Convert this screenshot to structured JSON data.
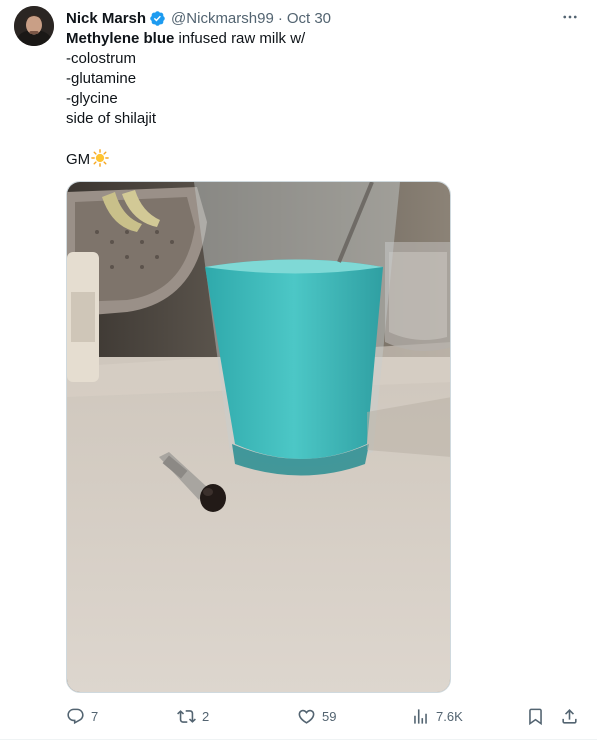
{
  "author": {
    "display_name": "Nick Marsh",
    "handle": "@Nickmarsh99",
    "separator": "·",
    "date": "Oct 30",
    "verified_color": "#1d9bf0"
  },
  "tweet": {
    "bold_text": "Methylene blue",
    "first_line_rest": " infused raw milk w/",
    "lines": [
      "-colostrum",
      "-glutamine",
      "-glycine",
      "side of shilajit"
    ],
    "sign_off": "GM",
    "sign_off_emoji": "sun-emoji"
  },
  "media": {
    "icon": "photo",
    "milk_color": "#3fc1c1"
  },
  "actions": {
    "reply_count": "7",
    "retweet_count": "2",
    "like_count": "59",
    "view_count": "7.6K",
    "icon_color": "#536471"
  }
}
